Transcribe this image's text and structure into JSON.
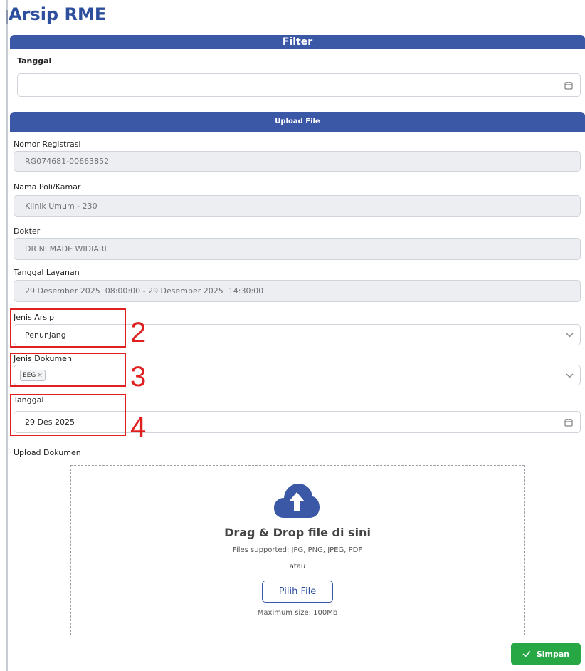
{
  "page": {
    "title": "Arsip RME"
  },
  "filter": {
    "header": "Filter",
    "date_label": "Tanggal",
    "date_value": "",
    "calendar_icon": "calendar-icon"
  },
  "upload": {
    "header": "Upload File",
    "fields": {
      "registration": {
        "label": "Nomor Registrasi",
        "value": "RG074681-00663852"
      },
      "poli": {
        "label": "Nama Poli/Kamar",
        "value": "Klinik Umum - 230"
      },
      "doctor": {
        "label": "Dokter",
        "value": "DR NI MADE WIDIARI"
      },
      "service_date": {
        "label": "Tanggal Layanan",
        "value": "29 Desember 2025  08:00:00 - 29 Desember 2025  14:30:00"
      },
      "archive_type": {
        "label": "Jenis Arsip",
        "value": "Penunjang",
        "icon": "chevron-down-icon"
      },
      "document_type": {
        "label": "Jenis Dokumen",
        "tags": [
          "EEG"
        ],
        "tag_remove": "×",
        "icon": "chevron-down-icon"
      },
      "date": {
        "label": "Tanggal",
        "value": "29 Des 2025",
        "icon": "calendar-icon"
      }
    },
    "dropzone": {
      "label": "Upload Dokumen",
      "icon": "cloud-upload-icon",
      "title": "Drag & Drop file di sini",
      "supported": "Files supported: JPG, PNG, JPEG, PDF",
      "or": "atau",
      "button": "Pilih File",
      "max_size": "Maximum size: 100Mb"
    },
    "save_button": {
      "label": "Simpan",
      "icon": "check-icon"
    }
  },
  "annotations": [
    "2",
    "3",
    "4"
  ],
  "colors": {
    "primary": "#3b58a6",
    "title": "#2d4f9e",
    "success": "#28a745",
    "annotation": "#e02020"
  }
}
